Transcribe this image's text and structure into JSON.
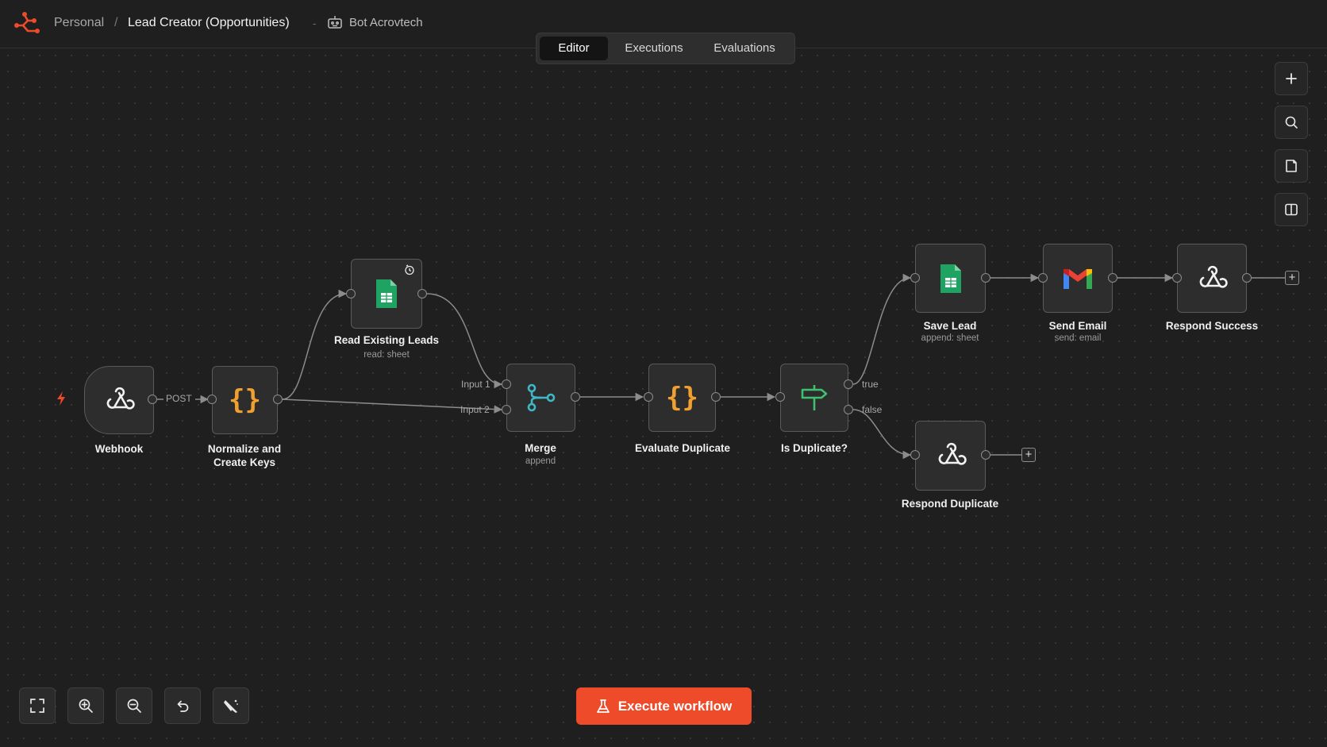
{
  "breadcrumb": {
    "workspace": "Personal",
    "separator": "/",
    "workflow_title": "Lead Creator (Opportunities)",
    "dash": "-",
    "owner": "Bot Acrovtech"
  },
  "tabs": [
    {
      "label": "Editor",
      "active": true
    },
    {
      "label": "Executions",
      "active": false
    },
    {
      "label": "Evaluations",
      "active": false
    }
  ],
  "right_toolbar": [
    "plus-icon",
    "search-icon",
    "sticky-note-icon",
    "panel-toggle-icon"
  ],
  "nodes": {
    "webhook": {
      "label": "Webhook",
      "icon": "webhook-icon"
    },
    "normalize": {
      "label1": "Normalize and",
      "label2": "Create Keys",
      "icon": "code-braces-icon"
    },
    "read_leads": {
      "label": "Read Existing Leads",
      "sub": "read: sheet",
      "icon": "google-sheets-icon"
    },
    "merge": {
      "label": "Merge",
      "sub": "append",
      "icon": "merge-icon"
    },
    "evaluate": {
      "label": "Evaluate Duplicate",
      "icon": "code-braces-icon"
    },
    "is_duplicate": {
      "label": "Is Duplicate?",
      "icon": "signpost-icon"
    },
    "save_lead": {
      "label": "Save Lead",
      "sub": "append: sheet",
      "icon": "google-sheets-icon"
    },
    "send_email": {
      "label": "Send Email",
      "sub": "send: email",
      "icon": "gmail-icon"
    },
    "respond_success": {
      "label": "Respond Success",
      "icon": "webhook-icon"
    },
    "respond_duplicate": {
      "label": "Respond Duplicate",
      "icon": "webhook-icon"
    }
  },
  "edge_labels": {
    "post": "POST",
    "input1": "Input 1",
    "input2": "Input 2",
    "true": "true",
    "false": "false"
  },
  "plus_symbol": "+",
  "execute_button": {
    "label": "Execute workflow",
    "color": "#ee4b2b"
  },
  "bottom_controls": [
    "fit-view-icon",
    "zoom-in-icon",
    "zoom-out-icon",
    "undo-icon",
    "tidy-up-icon"
  ],
  "colors": {
    "accent": "#ee4b2b",
    "sheets_green": "#1ea362",
    "code_orange": "#f0a030",
    "merge_teal": "#3fb7c7",
    "if_green": "#3fbf6f"
  }
}
